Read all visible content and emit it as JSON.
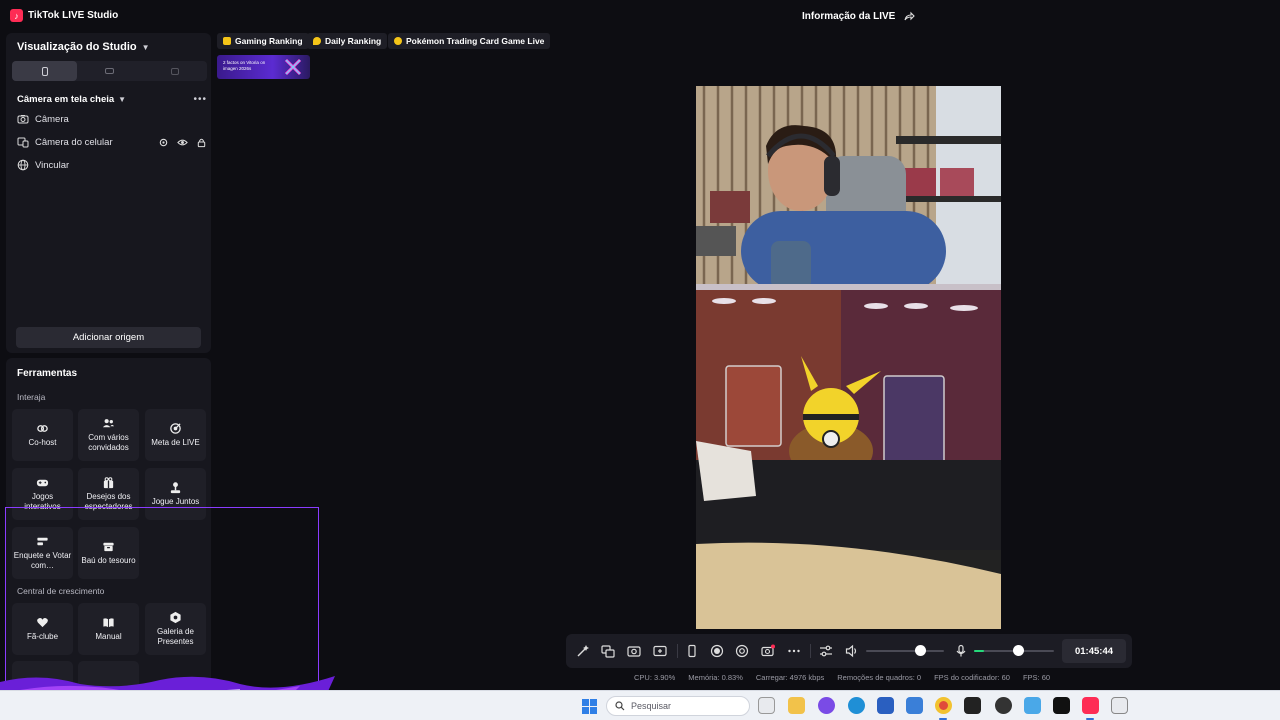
{
  "app": {
    "title": "TikTok LIVE Studio",
    "logo": "tiktok-logo-icon",
    "live_info": "Informação da LIVE"
  },
  "studio": {
    "title": "Visualização do Studio",
    "view_modes": [
      "phone-portrait-icon",
      "landscape-icon",
      "locked-layout-icon"
    ],
    "scene": "Câmera em tela cheia",
    "sources": [
      {
        "label": "Câmera",
        "icon": "camera-icon"
      },
      {
        "label": "Câmera do celular",
        "icon": "phone-camera-icon"
      },
      {
        "label": "Vincular",
        "icon": "globe-icon"
      }
    ],
    "add_source": "Adicionar origem"
  },
  "tools": {
    "title": "Ferramentas",
    "interact_label": "Interaja",
    "interact": [
      {
        "label": "Co-host",
        "icon": "link-icon"
      },
      {
        "label": "Com vários convidados",
        "icon": "multi-guest-icon"
      },
      {
        "label": "Meta de LIVE",
        "icon": "target-icon"
      },
      {
        "label": "Jogos interativos",
        "icon": "gamepad-icon"
      },
      {
        "label": "Desejos dos espectadores",
        "icon": "gift-icon"
      },
      {
        "label": "Jogue Juntos",
        "icon": "joystick-icon"
      },
      {
        "label": "Enquete e Votar com…",
        "icon": "poll-icon"
      },
      {
        "label": "Baú do tesouro",
        "icon": "treasure-chest-icon"
      }
    ],
    "growth_label": "Central de crescimento",
    "growth": [
      {
        "label": "Fã-clube",
        "icon": "heart-icon"
      },
      {
        "label": "Manual",
        "icon": "book-icon"
      },
      {
        "label": "Galeria de Presentes",
        "icon": "gift-gallery-icon"
      }
    ]
  },
  "rankings": [
    {
      "label": "Gaming Ranking",
      "color": "#f5c518"
    },
    {
      "label": "Daily Ranking",
      "color": "#f5c518"
    },
    {
      "label": "Pokémon Trading Card Game Live",
      "color": "#f5c518"
    }
  ],
  "banner": {
    "text": "2 factos on Vitoria on imagen 2026s"
  },
  "controls": {
    "icons": [
      "magic-wand-icon",
      "translate-icon",
      "screenshot-icon",
      "add-screen-icon",
      "phone-icon",
      "record-icon",
      "stream-settings-icon",
      "camera-live-icon",
      "more-icon",
      "mixer-icon",
      "volume-icon",
      "microphone-icon"
    ],
    "volume_level": 0.7,
    "mic_level": 0.55,
    "timer": "01:45:44"
  },
  "status": {
    "cpu": "CPU: 3.90%",
    "memory": "Memória: 0.83%",
    "upload": "Carregar: 4976 kbps",
    "dropped": "Remoções de quadros: 0",
    "encoder_fps": "FPS do codificador: 60",
    "fps": "FPS: 60"
  },
  "taskbar": {
    "search_placeholder": "Pesquisar"
  }
}
